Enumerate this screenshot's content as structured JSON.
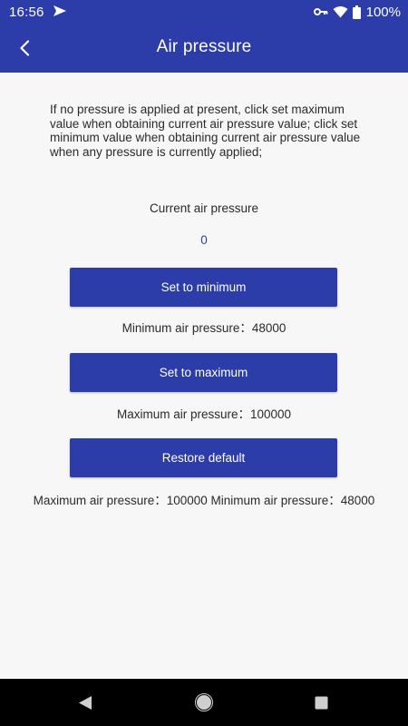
{
  "status_bar": {
    "time": "16:56",
    "battery_text": "100%",
    "icons": [
      "send-icon",
      "vpn-key-icon",
      "wifi-icon",
      "battery-icon"
    ]
  },
  "app_bar": {
    "title": "Air pressure",
    "back_icon": "chevron-left-icon"
  },
  "content": {
    "instructions": "If no pressure is applied at present, click set maximum value when obtaining current air pressure value; click set minimum value when obtaining current air pressure value when any pressure is currently applied;",
    "current_label": "Current air pressure",
    "current_value": "0",
    "set_min_label": "Set to minimum",
    "min_info": "Minimum air pressure：48000",
    "set_max_label": "Set to maximum",
    "max_info": "Maximum air pressure：100000",
    "restore_label": "Restore default",
    "restore_info": "Maximum air pressure：100000 Minimum air pressure：48000"
  },
  "colors": {
    "primary": "#2c3ca8",
    "background": "#f7f7f7",
    "nav_bar": "#000000"
  },
  "nav_bar": {
    "icons": [
      "nav-back-icon",
      "nav-home-icon",
      "nav-recents-icon"
    ]
  }
}
